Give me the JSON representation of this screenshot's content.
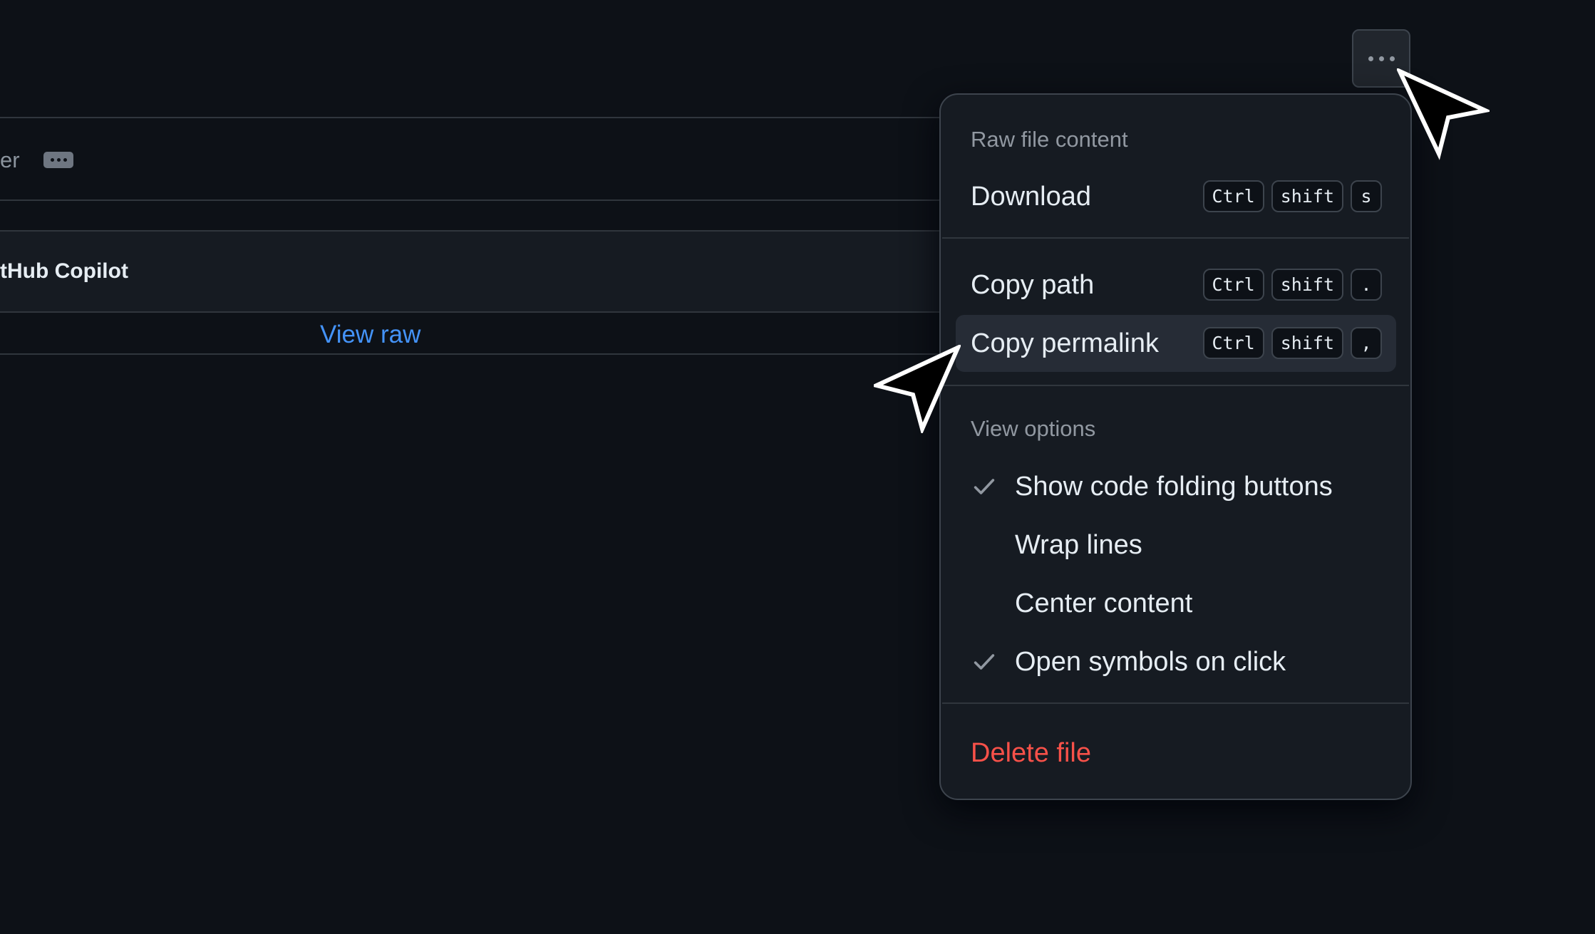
{
  "background": {
    "author_fragment": "er",
    "ellipsis_icon": "ellipsis-icon",
    "commit_author": "tHub Copilot",
    "view_raw": "View raw"
  },
  "kebab_button": {
    "icon": "kebab-horizontal-icon"
  },
  "menu": {
    "raw_group_label": "Raw file content",
    "items": [
      {
        "label": "Download",
        "keys": [
          "Ctrl",
          "shift",
          "s"
        ]
      },
      {
        "label": "Copy path",
        "keys": [
          "Ctrl",
          "shift",
          "."
        ]
      },
      {
        "label": "Copy permalink",
        "keys": [
          "Ctrl",
          "shift",
          ","
        ],
        "hovered": true
      }
    ],
    "view_group_label": "View options",
    "options": [
      {
        "label": "Show code folding buttons",
        "checked": true
      },
      {
        "label": "Wrap lines",
        "checked": false
      },
      {
        "label": "Center content",
        "checked": false
      },
      {
        "label": "Open symbols on click",
        "checked": true
      }
    ],
    "delete_label": "Delete file"
  },
  "colors": {
    "background": "#0d1117",
    "menu_bg": "#161b22",
    "hover_bg": "#262c36",
    "link": "#4493f8",
    "danger": "#f85149",
    "muted": "#9198a1"
  }
}
